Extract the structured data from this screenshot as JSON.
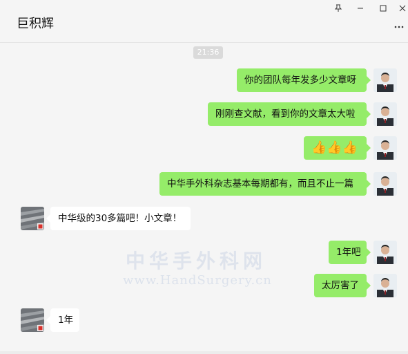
{
  "window": {
    "title": "巨积辉",
    "controls": {
      "pin_icon": "pin-icon",
      "minimize_icon": "minimize-icon",
      "maximize_icon": "maximize-icon",
      "close_icon": "close-icon",
      "more_icon": "more-icon"
    }
  },
  "chat": {
    "timestamp": "21:36",
    "messages": [
      {
        "side": "right",
        "text": "你的团队每年发多少文章呀"
      },
      {
        "side": "right",
        "text": "刚刚查文献，看到你的文章太大啦"
      },
      {
        "side": "right",
        "text": "👍👍👍"
      },
      {
        "side": "right",
        "text": "中华手外科杂志基本每期都有，而且不止一篇"
      },
      {
        "side": "left",
        "text": "中华级的30多篇吧！小文章！"
      },
      {
        "side": "right",
        "text": "1年吧"
      },
      {
        "side": "right",
        "text": "太厉害了"
      },
      {
        "side": "left",
        "text": "1年"
      }
    ]
  },
  "watermark": {
    "line1": "中华手外科网",
    "line2": "www.HandSurgery.cn"
  },
  "colors": {
    "outgoing_bubble": "#95ec69",
    "incoming_bubble": "#ffffff",
    "background": "#f5f5f5"
  }
}
